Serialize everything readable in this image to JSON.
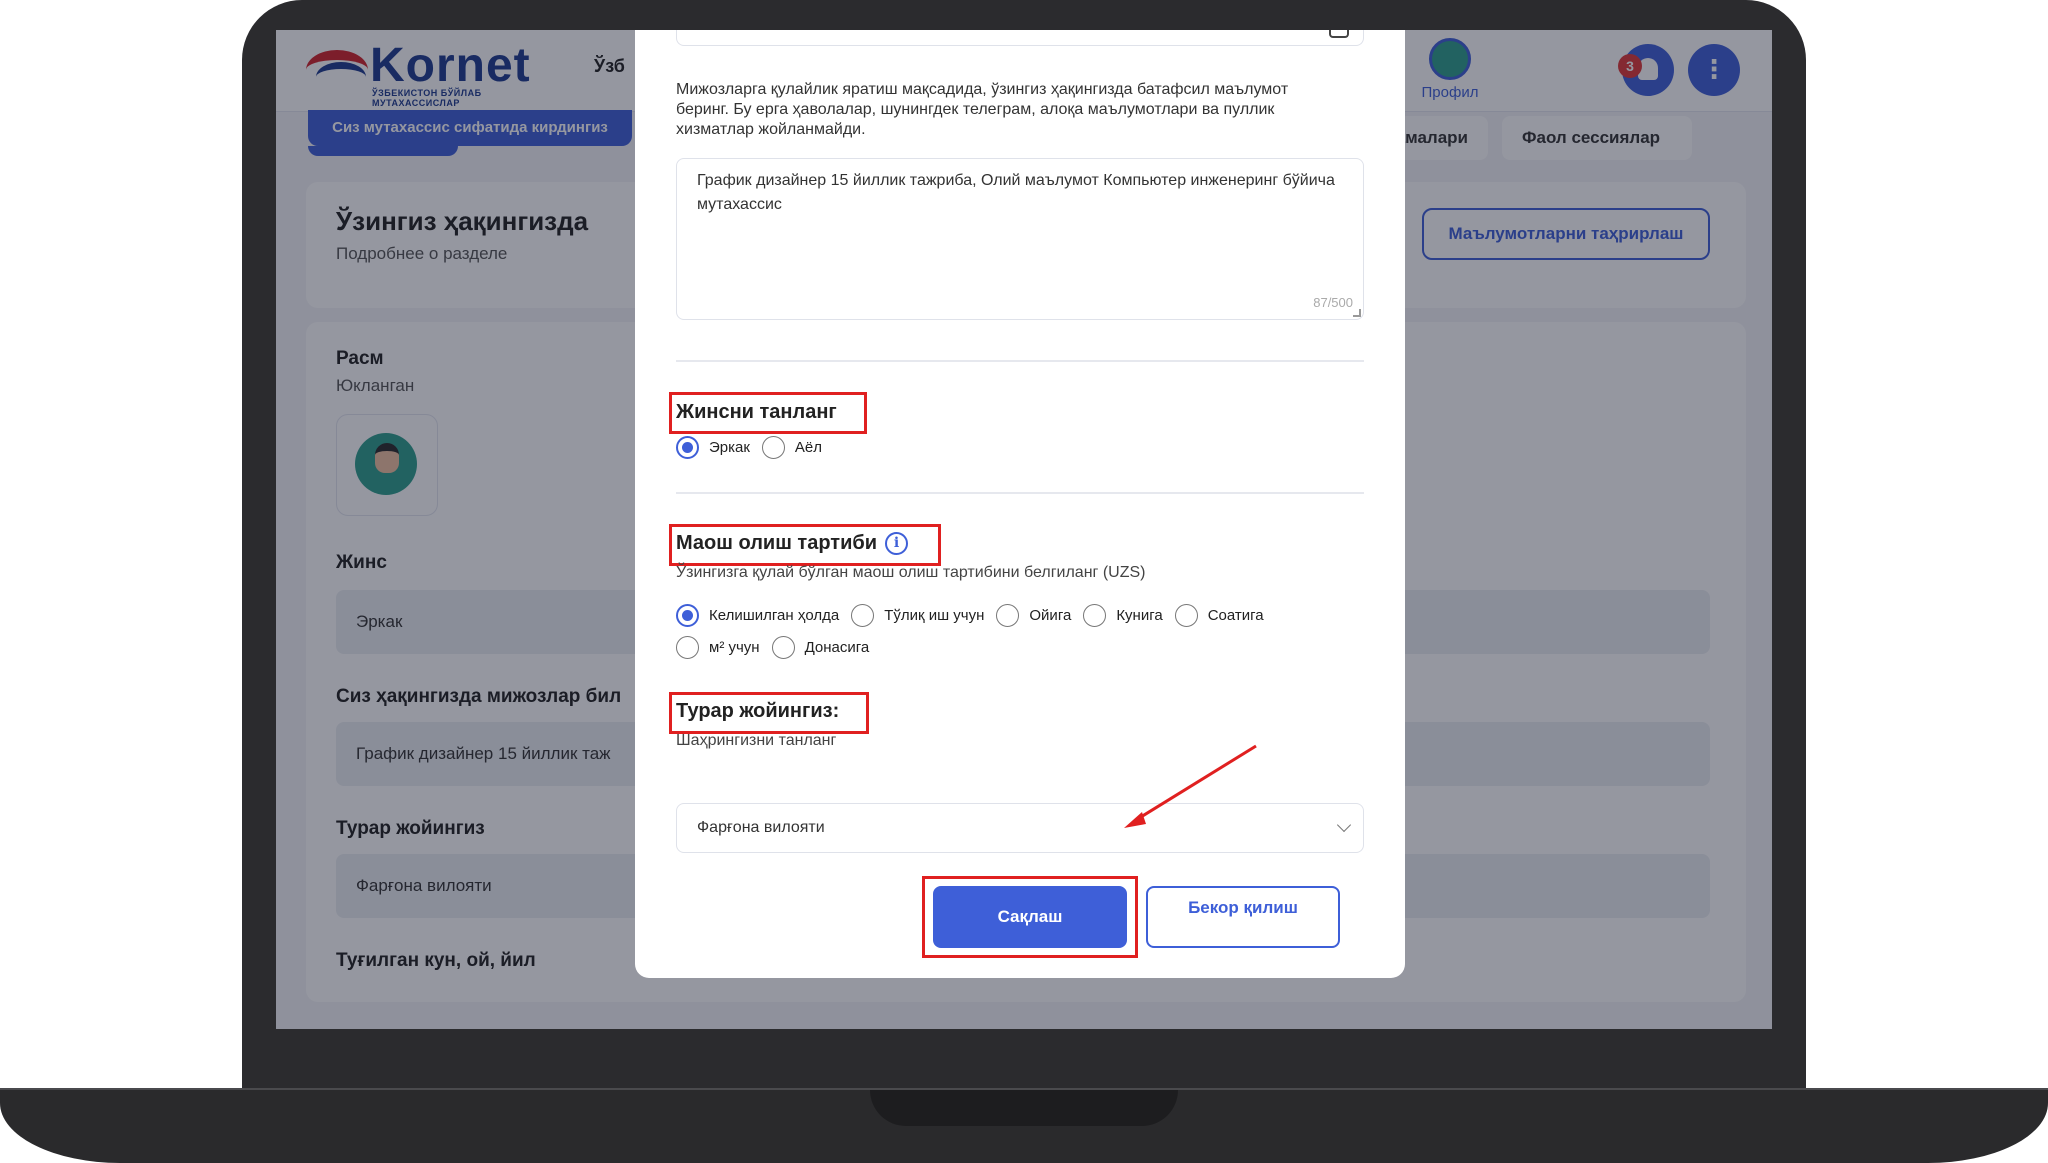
{
  "app": {
    "logo_text": "Kornet",
    "logo_subtitle": "ЎЗБЕКИСТОН БЎЙЛАБ МУТАХАССИСЛАР",
    "language": "Ўзб",
    "profile_label": "Профил",
    "notification_count": "3",
    "menu_icon": "⋮",
    "specialist_pill": "Сиз мутахассис сифатида кирдингиз",
    "tabs": [
      "ламалари",
      "Фаол сессиялар"
    ]
  },
  "page": {
    "title": "Ўзингиз ҳақингизда",
    "subtitle": "Подробнее о разделе",
    "edit_button": "Маълумотларни таҳрирлаш",
    "photo_label": "Расм",
    "photo_status": "Юкланган",
    "gender_label": "Жинс",
    "gender_value": "Эркак",
    "about_label": "Сиз ҳақингизда мижозлар бил",
    "about_value": "График дизайнер 15 йиллик таж",
    "residence_label": "Турар жойингиз",
    "residence_value": "Фарғона вилояти",
    "birth_label": "Туғилган кун, ой, йил"
  },
  "modal": {
    "description": "Мижозларга қулайлик яратиш мақсадида, ўзингиз ҳақингизда батафсил маълумот беринг. Бу ерга ҳаволалар, шунингдек телеграм, алоқа маълумотлари ва пуллик хизматлар жойланмайди.",
    "about_text": "График дизайнер 15 йиллик тажриба, Олий маълумот Компьютер инженеринг бўйича мутахассис",
    "counter": "87/500",
    "gender_title": "Жинсни танланг",
    "gender_options": [
      "Эркак",
      "Аёл"
    ],
    "gender_selected": "Эркак",
    "salary_title": "Маош олиш тартиби",
    "salary_help": "Ўзингизга қулай бўлган маош олиш тартибини белгиланг (UZS)",
    "salary_options": [
      "Келишилган ҳолда",
      "Тўлиқ иш учун",
      "Ойига",
      "Кунига",
      "Соатига",
      "м² учун",
      "Донасига"
    ],
    "salary_selected": "Келишилган ҳолда",
    "residence_title": "Турар жойингиз:",
    "residence_help": "Шаҳрингизни танланг",
    "residence_selected": "Фарғона вилояти",
    "save_button": "Сақлаш",
    "cancel_button": "Бекор қилиш",
    "info_icon": "i"
  },
  "colors": {
    "accent": "#3e5fd8",
    "highlight": "#e02020",
    "brand_red": "#d2232a",
    "brand_blue": "#1e3b8f"
  }
}
